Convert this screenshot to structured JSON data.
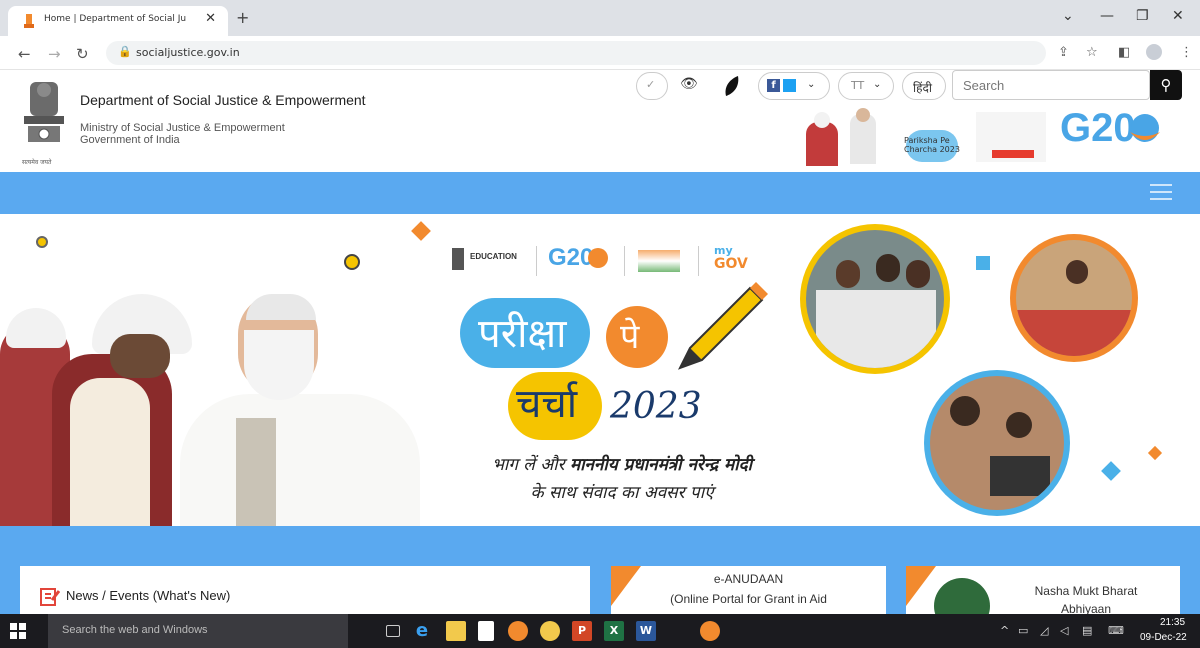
{
  "browser": {
    "tab_title": "Home | Department of Social Ju",
    "tab_close": "✕",
    "new_tab": "+",
    "url": "socialjustice.gov.in"
  },
  "header": {
    "dept_title": "Department of Social Justice & Empowerment",
    "ministry_line1": "Ministry of Social Justice & Empowerment",
    "ministry_line2": "Government of India",
    "emblem_caption": "सत्यमेव जयते",
    "font_size_label": "TT",
    "hindi_label": "हिंदी",
    "search_placeholder": "Search"
  },
  "promo": {
    "pariksha_mini": "Pariksha Pe Charcha 2023",
    "g20": "G20"
  },
  "banner": {
    "ministry_edu": "EDUCATION",
    "g20": "G20",
    "mygov_my": "my",
    "mygov_gov": "GOV",
    "title_line1": "परीक्षा",
    "title_pe": "पे",
    "title_line2": "चर्चा",
    "title_year": "2023",
    "tagline1_a": "भाग लें और ",
    "tagline1_b": "माननीय प्रधानमंत्री नरेन्द्र मोदी",
    "tagline2": "के साथ संवाद का अवसर पाएं"
  },
  "cards": {
    "news_title": "News / Events (What's New)",
    "anudaan_title": "e-ANUDAAN",
    "anudaan_sub": "(Online Portal for Grant in Aid",
    "nasha_title": "Nasha Mukt Bharat",
    "nasha_sub": "Abhiyaan"
  },
  "taskbar": {
    "search_placeholder": "Search the web and Windows",
    "time": "21:35",
    "date": "09-Dec-22"
  },
  "colors": {
    "blue_bar": "#5aa9f0",
    "orange": "#f28a2e",
    "chrome_bg": "#dee1e6"
  }
}
